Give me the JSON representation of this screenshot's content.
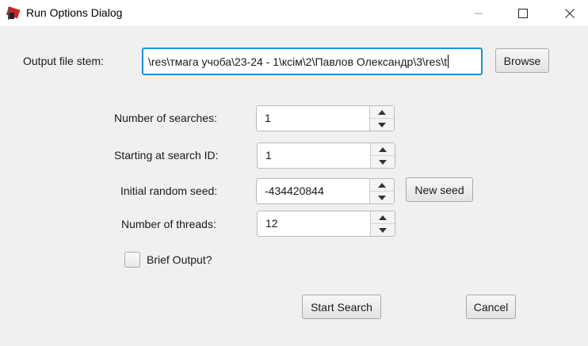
{
  "window": {
    "title": "Run Options Dialog",
    "accent": "#1e90d8"
  },
  "form": {
    "output_stem_label": "Output file stem:",
    "output_stem_value": "\\res\\тмага учоба\\23-24 - 1\\ксім\\2\\Павлов Олександр\\3\\res\\t",
    "browse_label": "Browse",
    "num_searches_label": "Number of searches:",
    "num_searches_value": "1",
    "start_id_label": "Starting at search ID:",
    "start_id_value": "1",
    "seed_label": "Initial random seed:",
    "seed_value": "-434420844",
    "new_seed_label": "New seed",
    "threads_label": "Number of threads:",
    "threads_value": "12",
    "brief_output_label": "Brief Output?",
    "brief_output_checked": false
  },
  "actions": {
    "start_label": "Start Search",
    "cancel_label": "Cancel"
  },
  "icons": {
    "app": "dialog-app-icon",
    "minimize": "minimize-icon",
    "maximize": "maximize-icon",
    "close": "close-icon",
    "spin_up": "chevron-up-icon",
    "spin_down": "chevron-down-icon"
  }
}
